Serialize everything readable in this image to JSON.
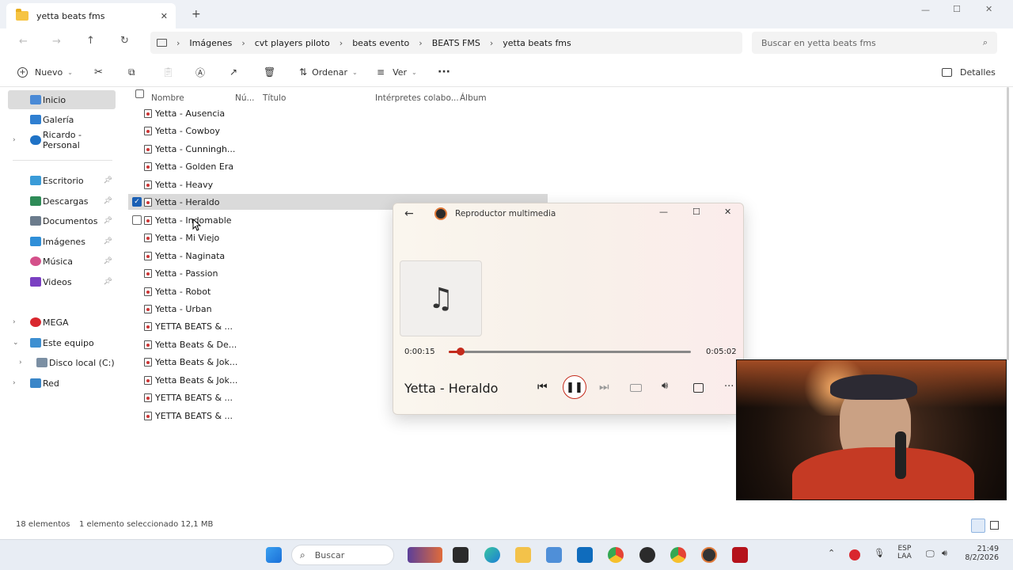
{
  "window": {
    "tab_title": "yetta beats fms",
    "tab_close": "✕",
    "new_tab": "+",
    "controls": {
      "minimize": "—",
      "maximize": "☐",
      "close": "✕"
    }
  },
  "address": {
    "breadcrumb": [
      "Imágenes",
      "cvt players  piloto",
      "beats evento",
      "BEATS FMS",
      "yetta beats fms"
    ],
    "search_placeholder": "Buscar en yetta beats fms"
  },
  "toolbar": {
    "new_label": "Nuevo",
    "sort_label": "Ordenar",
    "view_label": "Ver",
    "more_label": "···",
    "details_label": "Detalles"
  },
  "sidebar": {
    "items": [
      {
        "label": "Inicio"
      },
      {
        "label": "Galería"
      },
      {
        "label": "Ricardo - Personal"
      },
      {
        "label": "Escritorio"
      },
      {
        "label": "Descargas"
      },
      {
        "label": "Documentos"
      },
      {
        "label": "Imágenes"
      },
      {
        "label": "Música"
      },
      {
        "label": "Videos"
      },
      {
        "label": "MEGA"
      },
      {
        "label": "Este equipo"
      },
      {
        "label": "Disco local (C:)"
      },
      {
        "label": "Red"
      }
    ]
  },
  "columns": {
    "name": "Nombre",
    "number": "Nú...",
    "title": "Título",
    "artists": "Intérpretes colabo...",
    "album": "Álbum"
  },
  "files": [
    "Yetta - Ausencia",
    "Yetta - Cowboy",
    "Yetta - Cunningh...",
    "Yetta - Golden Era",
    "Yetta - Heavy",
    "Yetta - Heraldo",
    "Yetta - Indomable",
    "Yetta - Mi Viejo",
    "Yetta - Naginata",
    "Yetta - Passion",
    "Yetta - Robot",
    "Yetta - Urban",
    "YETTA BEATS & ...",
    "Yetta Beats & De...",
    "Yetta Beats & Jok...",
    "Yetta Beats & Jok...",
    "YETTA BEATS & ...",
    "YETTA BEATS & ..."
  ],
  "status": {
    "count": "18 elementos",
    "selection": "1 elemento seleccionado  12,1 MB"
  },
  "player": {
    "title": "Reproductor multimedia",
    "elapsed": "0:00:15",
    "duration": "0:05:02",
    "progress": 0.05,
    "track": "Yetta - Heraldo"
  },
  "taskbar": {
    "search_label": "Buscar",
    "lang_top": "ESP",
    "lang_bottom": "LAA",
    "time": "21:49",
    "date": "8/2/2026"
  },
  "colors": {
    "accent": "#1a5fb4",
    "player_accent": "#c42b1c"
  }
}
